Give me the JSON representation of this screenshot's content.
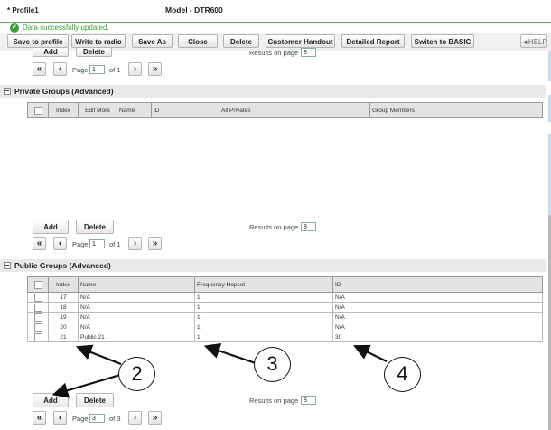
{
  "header": {
    "profile": "* Profile1",
    "model": "Model - DTR600"
  },
  "notice": {
    "text": "Data successfully updated."
  },
  "toolbar": {
    "save_to_profile": "Save to profile",
    "write_to_radio": "Write to radio",
    "save_as": "Save As",
    "close": "Close",
    "delete": "Delete",
    "customer_handout": "Customer Handout",
    "detailed_report": "Detailed Report",
    "switch_basic": "Switch to BASIC",
    "help": "◄HELP"
  },
  "top_pager": {
    "add": "Add",
    "delete": "Delete",
    "results_label": "Results on page",
    "results_value": "8",
    "page_label": "Page",
    "page_value": "1",
    "of_label": "of 1"
  },
  "private": {
    "title": "Private Groups (Advanced)",
    "columns": [
      "",
      "Index",
      "Edit More",
      "Name",
      "ID",
      "All Privates",
      "Group Members"
    ],
    "add": "Add",
    "delete": "Delete",
    "results_label": "Results on page",
    "results_value": "8",
    "page_label": "Page",
    "page_value": "1",
    "of_label": "of 1"
  },
  "public": {
    "title": "Public Groups (Advanced)",
    "columns": [
      "",
      "Index",
      "Name",
      "Frequency Hopset",
      "ID"
    ],
    "rows": [
      {
        "index": "17",
        "name": "N/A",
        "hopset": "1",
        "id": "N/A"
      },
      {
        "index": "18",
        "name": "N/A",
        "hopset": "1",
        "id": "N/A"
      },
      {
        "index": "19",
        "name": "N/A",
        "hopset": "1",
        "id": "N/A"
      },
      {
        "index": "20",
        "name": "N/A",
        "hopset": "1",
        "id": "N/A"
      },
      {
        "index": "21",
        "name": "Public 21",
        "hopset": "1",
        "id": "30"
      }
    ],
    "add": "Add",
    "delete": "Delete",
    "results_label": "Results on page",
    "results_value": "8",
    "page_label": "Page",
    "page_value": "3",
    "of_label": "of 3"
  },
  "callouts": [
    "2",
    "3",
    "4"
  ]
}
